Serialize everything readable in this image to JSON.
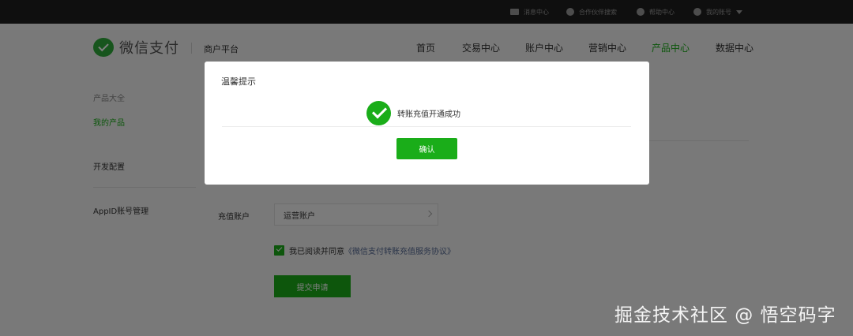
{
  "topbar": {
    "items": [
      {
        "label": "消息中心",
        "icon": "message-icon"
      },
      {
        "label": "合作伙伴搜索",
        "icon": "partner-icon"
      },
      {
        "label": "帮助中心",
        "icon": "help-icon"
      },
      {
        "label": "我的账号",
        "icon": "user-icon"
      }
    ]
  },
  "header": {
    "logo_text": "微信支付",
    "platform": "商户平台",
    "nav": [
      {
        "label": "首页"
      },
      {
        "label": "交易中心"
      },
      {
        "label": "账户中心"
      },
      {
        "label": "营销中心"
      },
      {
        "label": "产品中心",
        "active": true
      },
      {
        "label": "数据中心"
      }
    ]
  },
  "sidebar": {
    "items": [
      {
        "label": "产品大全"
      },
      {
        "label": "我的产品",
        "active": true
      },
      {
        "label": "开发配置"
      },
      {
        "label": "AppID账号管理"
      }
    ]
  },
  "form": {
    "recharge_account_label": "充值账户",
    "recharge_account_value": "运营账户",
    "agree_text": "我已阅读并同意",
    "agree_link": "《微信支付转账充值服务协议》",
    "submit_label": "提交申请"
  },
  "modal": {
    "title": "温馨提示",
    "status_text": "转账充值开通成功",
    "confirm_label": "确认"
  },
  "watermark": "掘金技术社区 @ 悟空码字",
  "colors": {
    "brand_green": "#1aad19",
    "topbar_bg": "#1e1e1e",
    "link": "#576b95"
  }
}
